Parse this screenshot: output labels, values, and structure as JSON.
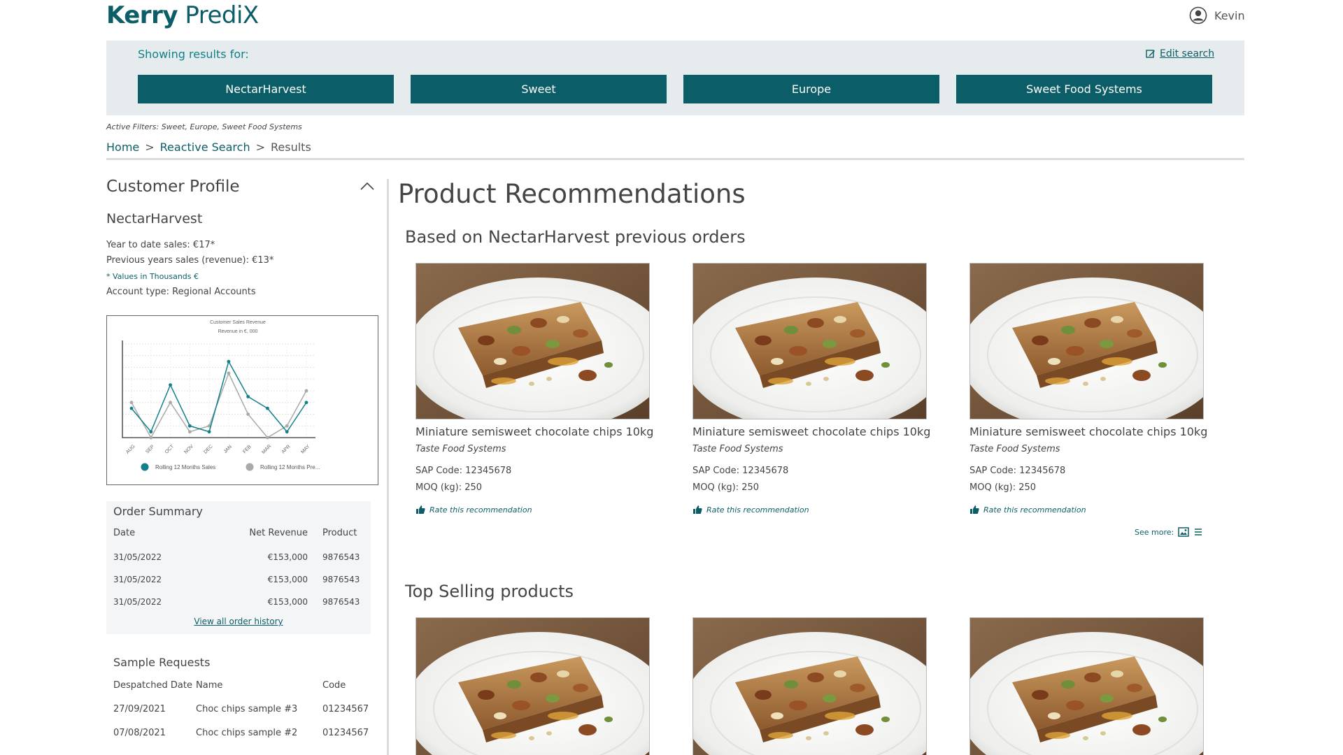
{
  "header": {
    "logo_bold": "Kerry",
    "logo_light": "PrediX",
    "user_name": "Kevin"
  },
  "search": {
    "showing_label": "Showing results for:",
    "edit_label": "Edit search",
    "chips": [
      "NectarHarvest",
      "Sweet",
      "Europe",
      "Sweet Food Systems"
    ],
    "active_filters": "Active Filters: Sweet, Europe, Sweet Food Systems"
  },
  "breadcrumb": {
    "home": "Home",
    "reactive": "Reactive Search",
    "current": "Results",
    "sep": ">"
  },
  "profile": {
    "title": "Customer Profile",
    "customer": "NectarHarvest",
    "ytd": "Year to date sales: €17*",
    "prev": "Previous years sales (revenue): €13*",
    "note": "* Values in Thousands €",
    "account": "Account type: Regional Accounts"
  },
  "chart_data": {
    "type": "line",
    "title": "Customer Sales Revenue",
    "subtitle": "Revenue in €, 000",
    "categories": [
      "AUG",
      "SEP",
      "OCT",
      "NOV",
      "DEC",
      "JAN",
      "FEB",
      "MAR",
      "APR",
      "MAY"
    ],
    "series": [
      {
        "name": "Rolling 12 Months Sales",
        "color": "#12808a",
        "values": [
          5,
          1,
          9,
          2,
          1,
          13,
          7,
          5,
          1,
          6
        ]
      },
      {
        "name": "Rolling 12 Months Pre...",
        "color": "#a9a9a9",
        "values": [
          6,
          0,
          6,
          1,
          2,
          11,
          4,
          0,
          2,
          8
        ]
      }
    ],
    "ylim": [
      0,
      16
    ],
    "grid": true,
    "legend": "bottom"
  },
  "orders": {
    "title": "Order Summary",
    "headers": [
      "Date",
      "Net Revenue",
      "Product"
    ],
    "rows": [
      [
        "31/05/2022",
        "€153,000",
        "9876543"
      ],
      [
        "31/05/2022",
        "€153,000",
        "9876543"
      ],
      [
        "31/05/2022",
        "€153,000",
        "9876543"
      ]
    ],
    "view_all": "View all order history"
  },
  "samples": {
    "title": "Sample Requests",
    "headers": [
      "Despatched Date",
      "Name",
      "Code"
    ],
    "rows": [
      [
        "27/09/2021",
        "Choc chips sample #3",
        "01234567"
      ],
      [
        "07/08/2021",
        "Choc chips sample #2",
        "01234567"
      ]
    ]
  },
  "recommendations": {
    "title": "Product Recommendations",
    "based_title": "Based on NectarHarvest previous orders",
    "top_title": "Top Selling products",
    "see_more": "See more:",
    "products": [
      {
        "name": "Miniature semisweet chocolate chips 10kg",
        "supplier": "Taste Food Systems",
        "sap": "SAP Code: 12345678",
        "moq": "MOQ (kg): 250",
        "rate": "Rate this recommendation"
      },
      {
        "name": "Miniature semisweet chocolate chips 10kg",
        "supplier": "Taste Food Systems",
        "sap": "SAP Code: 12345678",
        "moq": "MOQ (kg): 250",
        "rate": "Rate this recommendation"
      },
      {
        "name": "Miniature semisweet chocolate chips 10kg",
        "supplier": "Taste Food Systems",
        "sap": "SAP Code: 12345678",
        "moq": "MOQ (kg): 250",
        "rate": "Rate this recommendation"
      }
    ]
  }
}
